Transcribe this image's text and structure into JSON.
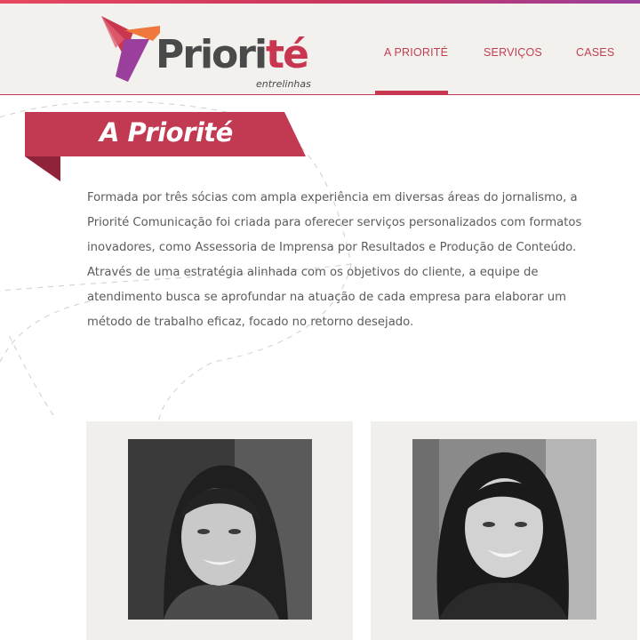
{
  "brand": {
    "name_main": "Priori",
    "name_accent": "té",
    "tagline": "entrelinhas",
    "colors": {
      "primary": "#c8364f",
      "purple": "#9b3f9c",
      "orange": "#f0783c",
      "text": "#4a4a4a"
    }
  },
  "nav": {
    "items": [
      {
        "label": "A PRIORITÉ",
        "active": true
      },
      {
        "label": "SERVIÇOS",
        "active": false
      },
      {
        "label": "CASES",
        "active": false
      }
    ]
  },
  "section": {
    "title": "A Priorité",
    "intro_lines": [
      "Formada por três sócias com ampla experiência em diversas áreas do jornalismo, a",
      "Priorité Comunicação foi criada para oferecer serviços personalizados com formatos",
      "inovadores, como Assessoria de Imprensa por Resultados e Produção de Conteúdo.",
      "Através de uma estratégia alinhada com os objetivos do cliente, a equipe de",
      "atendimento busca se aprofundar na atuação de cada empresa para elaborar um",
      "método de trabalho eficaz, focado no retorno desejado."
    ]
  },
  "team": {
    "cards": [
      {
        "photo": "partner-photo-1"
      },
      {
        "photo": "partner-photo-2"
      }
    ]
  }
}
